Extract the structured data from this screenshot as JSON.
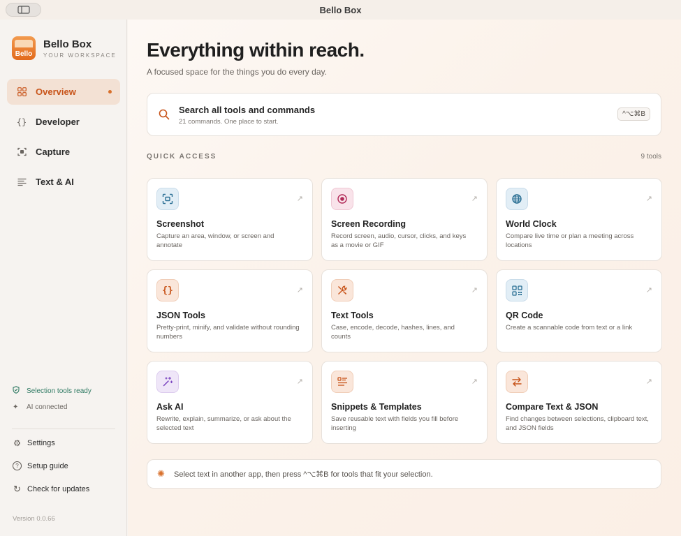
{
  "window": {
    "title": "Bello Box"
  },
  "brand": {
    "logo_text": "Bello",
    "name": "Bello Box",
    "subtitle": "YOUR WORKSPACE"
  },
  "nav": [
    {
      "label": "Overview",
      "icon": "grid-icon",
      "active": true
    },
    {
      "label": "Developer",
      "icon": "braces-icon"
    },
    {
      "label": "Capture",
      "icon": "capture-icon"
    },
    {
      "label": "Text & AI",
      "icon": "lines-icon"
    }
  ],
  "status": {
    "selection": "Selection tools ready",
    "ai": "AI connected"
  },
  "footer": {
    "settings": "Settings",
    "setup": "Setup guide",
    "updates": "Check for updates",
    "version": "Version 0.0.66"
  },
  "hero": {
    "title": "Everything within reach.",
    "subtitle": "A focused space for the things you do every day."
  },
  "search": {
    "title": "Search all tools and commands",
    "subtitle": "21 commands. One place to start.",
    "shortcut": "^⌥⌘B"
  },
  "quick_access": {
    "label": "QUICK ACCESS",
    "count": "9 tools",
    "cards": [
      {
        "title": "Screenshot",
        "desc": "Capture an area, window, or screen and annotate",
        "icon": "screenshot-icon",
        "color": "blue"
      },
      {
        "title": "Screen Recording",
        "desc": "Record screen, audio, cursor, clicks, and keys as a movie or GIF",
        "icon": "record-icon",
        "color": "pink"
      },
      {
        "title": "World Clock",
        "desc": "Compare live time or plan a meeting across locations",
        "icon": "globe-icon",
        "color": "blue"
      },
      {
        "title": "JSON Tools",
        "desc": "Pretty-print, minify, and validate without rounding numbers",
        "icon": "braces-icon",
        "color": "orange"
      },
      {
        "title": "Text Tools",
        "desc": "Case, encode, decode, hashes, lines, and counts",
        "icon": "tools-icon",
        "color": "orange"
      },
      {
        "title": "QR Code",
        "desc": "Create a scannable code from text or a link",
        "icon": "qr-icon",
        "color": "blue"
      },
      {
        "title": "Ask AI",
        "desc": "Rewrite, explain, summarize, or ask about the selected text",
        "icon": "magic-wand-icon",
        "color": "purple"
      },
      {
        "title": "Snippets & Templates",
        "desc": "Save reusable text with fields you fill before inserting",
        "icon": "snippet-icon",
        "color": "orange"
      },
      {
        "title": "Compare Text & JSON",
        "desc": "Find changes between selections, clipboard text, and JSON fields",
        "icon": "compare-icon",
        "color": "orange"
      }
    ]
  },
  "hint": {
    "text": "Select text in another app, then press ^⌥⌘B for tools that fit your selection."
  },
  "colors": {
    "accent": "#c8541a",
    "active_bg": "#f3e1d4",
    "status_green": "#2f7a63"
  }
}
